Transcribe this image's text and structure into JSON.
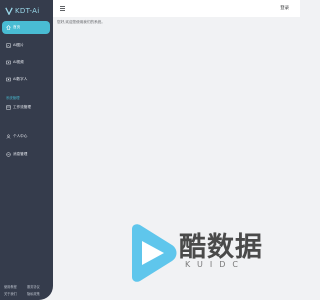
{
  "app": {
    "logo_text": "KDT-Ai"
  },
  "sidebar": {
    "items": [
      {
        "label": "首页",
        "icon": "home-icon",
        "active": true
      },
      {
        "label": "AI图片",
        "icon": "image-icon",
        "active": false
      },
      {
        "label": "AI视频",
        "icon": "video-icon",
        "active": false
      },
      {
        "label": "AI数字人",
        "icon": "digital-human-icon",
        "active": false
      },
      {
        "label": "工作流管理",
        "icon": "workflow-icon",
        "active": false
      },
      {
        "label": "个人中心",
        "icon": "user-icon",
        "active": false
      },
      {
        "label": "消息管理",
        "icon": "message-icon",
        "active": false
      }
    ],
    "section_title": "系统管理",
    "footer": [
      "使用教程",
      "服务协议",
      "关于我们",
      "隐私政策"
    ]
  },
  "header": {
    "login_label": "登录"
  },
  "main": {
    "welcome_text": "您好,欢迎您使用我们的系统。"
  },
  "watermark": {
    "text": "酷数据",
    "sub": "KUIDC"
  },
  "colors": {
    "sidebar_bg": "#353c4c",
    "accent": "#49bcd3",
    "page_bg": "#f1f2f4"
  }
}
